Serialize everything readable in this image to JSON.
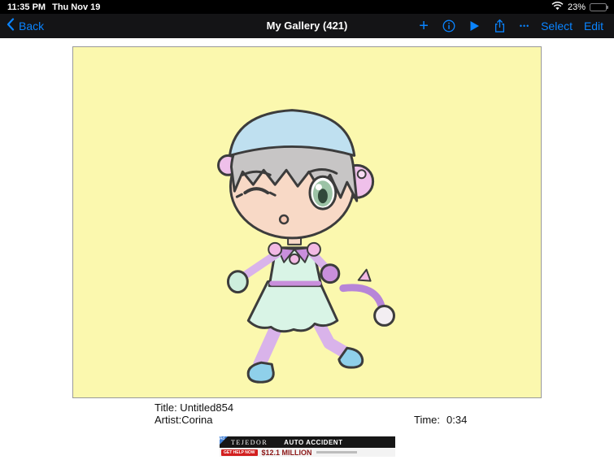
{
  "status_bar": {
    "time": "11:35 PM",
    "date": "Thu Nov 19",
    "battery_percent": "23%"
  },
  "nav_bar": {
    "back_label": "Back",
    "title": "My Gallery (421)",
    "plus": "+",
    "more": "•••",
    "select_label": "Select",
    "edit_label": "Edit"
  },
  "gallery_item": {
    "title": "Title: Untitled854",
    "artist": "Artist:Corina",
    "time_label": "Time:",
    "time_value": "0:34"
  },
  "ad": {
    "badge": "Ad",
    "firm": "TEJEDOR",
    "headline": "AUTO ACCIDENT",
    "amount": "$12.1 MILLION",
    "cta": "GET HELP NOW"
  },
  "colors": {
    "accent": "#0a84ff",
    "canvas_bg": "#fbf8ae",
    "nav_bg": "#141416"
  }
}
